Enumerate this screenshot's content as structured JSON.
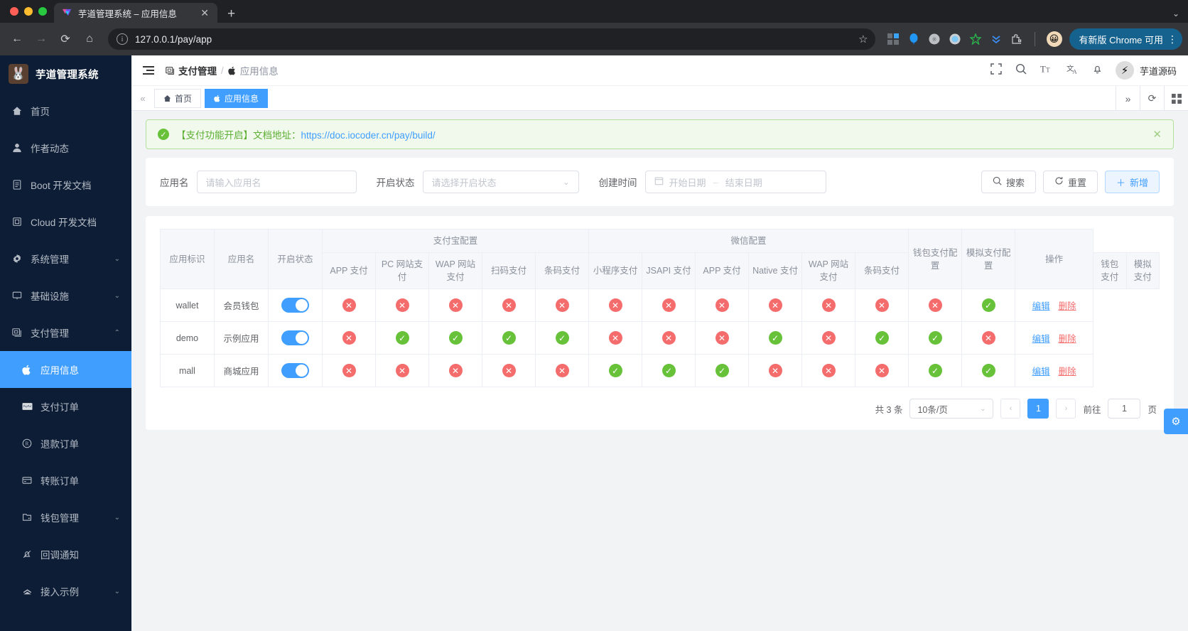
{
  "browser": {
    "tab_title": "芋道管理系统 – 应用信息",
    "tab_close": "✕",
    "new_tab": "+",
    "window_chevron": "⌄",
    "nav": {
      "back": "←",
      "forward": "→",
      "reload": "⟳",
      "home": "⌂"
    },
    "omnibox": {
      "info": "i",
      "url": "127.0.0.1/pay/app",
      "star": "☆"
    },
    "update_button": "有新版 Chrome 可用",
    "update_kebab": "⋮"
  },
  "sidebar": {
    "brand": "芋道管理系统",
    "brand_logo": "rabbit-avatar",
    "items": [
      {
        "label": "首页",
        "icon": "⌂",
        "arrow": ""
      },
      {
        "label": "作者动态",
        "icon": "👤",
        "arrow": ""
      },
      {
        "label": "Boot 开发文档",
        "icon": "🗎",
        "arrow": ""
      },
      {
        "label": "Cloud 开发文档",
        "icon": "🗐",
        "arrow": ""
      },
      {
        "label": "系统管理",
        "icon": "⚙",
        "arrow": "⌄"
      },
      {
        "label": "基础设施",
        "icon": "🖵",
        "arrow": "⌄"
      },
      {
        "label": "支付管理",
        "icon": "🖻",
        "arrow": "⌃"
      },
      {
        "label": "应用信息",
        "icon": "",
        "arrow": "",
        "sub": true,
        "active": true
      },
      {
        "label": "支付订单",
        "icon": "▤",
        "arrow": "",
        "sub": true
      },
      {
        "label": "退款订单",
        "icon": "®",
        "arrow": "",
        "sub": true
      },
      {
        "label": "转账订单",
        "icon": "▤",
        "arrow": "",
        "sub": true
      },
      {
        "label": "钱包管理",
        "icon": "🗀",
        "arrow": "⌄",
        "sub": true
      },
      {
        "label": "回调通知",
        "icon": "🔔",
        "arrow": "",
        "sub": true
      },
      {
        "label": "接入示例",
        "icon": "⚓",
        "arrow": "⌄",
        "sub": true
      }
    ]
  },
  "navbar": {
    "breadcrumb_parent": "支付管理",
    "breadcrumb_sep": "/",
    "breadcrumb_current": "应用信息",
    "icons": [
      "fullscreen-icon",
      "search-icon",
      "font-size-icon",
      "translate-icon",
      "bell-icon"
    ],
    "user_name": "芋道源码"
  },
  "tags": {
    "collapse": "«",
    "items": [
      {
        "label": "首页",
        "icon": "⌂",
        "active": false
      },
      {
        "label": "应用信息",
        "icon": "",
        "active": true
      }
    ],
    "more": "»",
    "refresh": "⟳",
    "grid": "▦"
  },
  "alert": {
    "icon": "✓",
    "text": "【支付功能开启】文档地址：",
    "link": "https://doc.iocoder.cn/pay/build/",
    "close": "✕"
  },
  "filters": {
    "app_name_label": "应用名",
    "app_name_placeholder": "请输入应用名",
    "app_name_value": "",
    "status_label": "开启状态",
    "status_placeholder": "请选择开启状态",
    "status_value": "",
    "status_chevron": "⌄",
    "time_label": "创建时间",
    "date_icon": "▤",
    "date_start_placeholder": "开始日期",
    "date_dash": "–",
    "date_end_placeholder": "结束日期",
    "search_button": "搜索",
    "search_icon": "⌕",
    "reset_button": "重置",
    "reset_icon": "⟳",
    "add_button": "新增",
    "add_icon": "＋"
  },
  "table": {
    "group_headers": [
      {
        "label": "应用标识",
        "rowspan": true
      },
      {
        "label": "应用名",
        "rowspan": true
      },
      {
        "label": "开启状态",
        "rowspan": true
      },
      {
        "label": "支付宝配置",
        "colspan": 5
      },
      {
        "label": "微信配置",
        "colspan": 6
      },
      {
        "label": "钱包支付配置",
        "rowspan": true
      },
      {
        "label": "模拟支付配置",
        "rowspan": true
      },
      {
        "label": "操作",
        "rowspan": true
      }
    ],
    "sub_headers": [
      "APP 支付",
      "PC 网站支付",
      "WAP 网站支付",
      "扫码支付",
      "条码支付",
      "小程序支付",
      "JSAPI 支付",
      "APP 支付",
      "Native 支付",
      "WAP 网站支付",
      "条码支付",
      "钱包支付",
      "模拟支付"
    ],
    "rows": [
      {
        "key": "wallet",
        "name": "会员钱包",
        "enabled": true,
        "flags": [
          false,
          false,
          false,
          false,
          false,
          false,
          false,
          false,
          false,
          false,
          false,
          false,
          true
        ],
        "actions": [
          "编辑",
          "删除"
        ]
      },
      {
        "key": "demo",
        "name": "示例应用",
        "enabled": true,
        "flags": [
          false,
          true,
          true,
          true,
          true,
          false,
          false,
          false,
          true,
          false,
          true,
          true,
          false
        ],
        "actions": [
          "编辑",
          "删除"
        ]
      },
      {
        "key": "mall",
        "name": "商城应用",
        "enabled": true,
        "flags": [
          false,
          false,
          false,
          false,
          false,
          true,
          true,
          true,
          false,
          false,
          false,
          true,
          true
        ],
        "actions": [
          "编辑",
          "删除"
        ]
      }
    ],
    "icon_true": "✓",
    "icon_false": "✕"
  },
  "pagination": {
    "total_text": "共 3 条",
    "page_size": "10条/页",
    "page_size_chevron": "⌄",
    "prev": "‹",
    "next": "›",
    "current_page": "1",
    "goto_label": "前往",
    "goto_value": "1",
    "page_unit": "页"
  },
  "fab": {
    "icon": "⚙"
  },
  "colors": {
    "accent": "#409eff",
    "success": "#67c23a",
    "danger": "#f56c6c",
    "sidebar_bg": "#0c1d35"
  }
}
